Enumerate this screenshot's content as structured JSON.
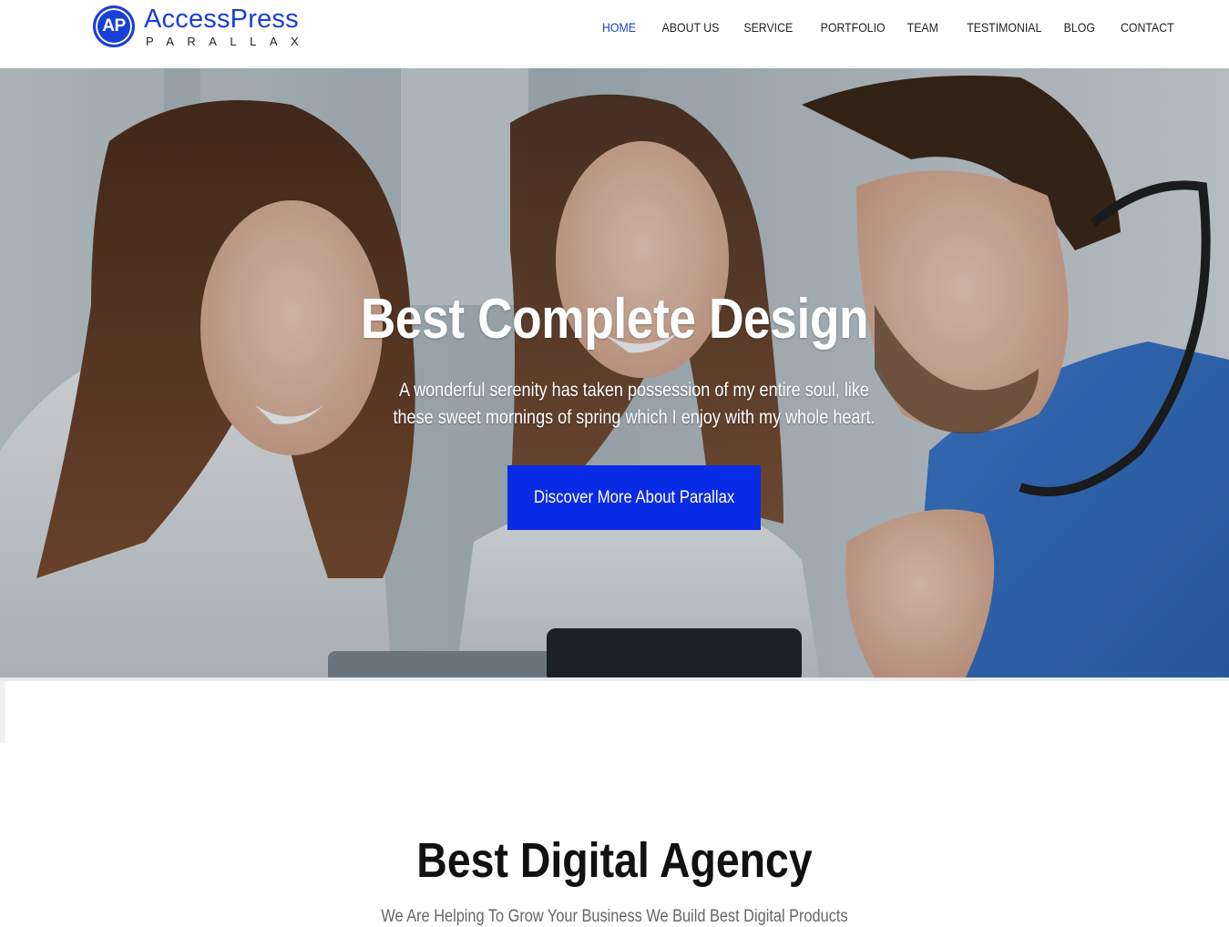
{
  "brand": {
    "badge": "AP",
    "name": "AccessPress",
    "tagline": "PARALLAX",
    "color": "#1a3fd6"
  },
  "nav": {
    "items": [
      {
        "label": "HOME",
        "active": true
      },
      {
        "label": "ABOUT US",
        "active": false
      },
      {
        "label": "SERVICE",
        "active": false
      },
      {
        "label": "PORTFOLIO",
        "active": false
      },
      {
        "label": "TEAM",
        "active": false
      },
      {
        "label": "TESTIMONIAL",
        "active": false
      },
      {
        "label": "BLOG",
        "active": false
      },
      {
        "label": "CONTACT",
        "active": false
      }
    ]
  },
  "hero": {
    "title": "Best Complete Design",
    "subtitle": "A wonderful serenity has taken possession of my entire soul, like these sweet mornings of spring which I enjoy with my whole heart.",
    "button_label": "Discover More About Parallax",
    "button_color": "#0a2be6"
  },
  "section": {
    "title": "Best Digital Agency",
    "subtitle": "We Are Helping To Grow Your Business We Build Best Digital Products"
  }
}
